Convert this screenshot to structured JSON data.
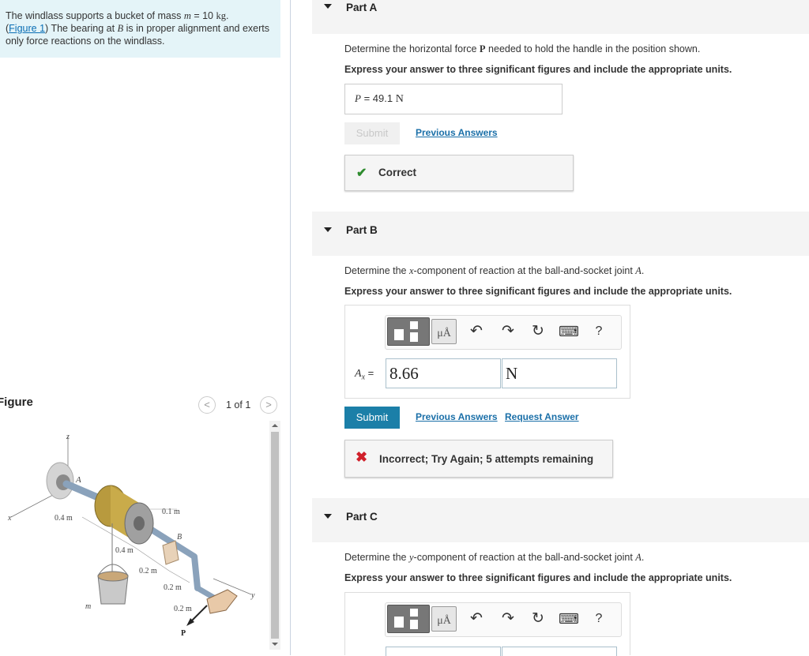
{
  "problem": {
    "text_pre": "The windlass supports a bucket of mass ",
    "mass_symbol": "m",
    "mass_equals": " = 10 ",
    "mass_unit": "kg",
    "period": ".",
    "figure_link": "Figure 1",
    "text_mid": ") The bearing at ",
    "bearing_symbol": "B",
    "text_post": " is in proper alignment and exerts only force reactions on the windlass.",
    "open_paren": "("
  },
  "figure": {
    "title": "Figure",
    "counter": "1 of 1",
    "prev": "<",
    "next": ">",
    "labels": {
      "z": "z",
      "A": "A",
      "x": "x",
      "y": "y",
      "B": "B",
      "m": "m",
      "P": "P",
      "d04a": "0.4 m",
      "d01": "0.1 m",
      "d04b": "0.4 m",
      "d02a": "0.2 m",
      "d02b": "0.2 m",
      "d02c": "0.2 m"
    }
  },
  "partA": {
    "label": "Part A",
    "question_pre": "Determine the horizontal force ",
    "question_sym": "P",
    "question_post": " needed to hold the handle in the position shown.",
    "instruction": "Express your answer to three significant figures and include the appropriate units.",
    "answer_var": "P",
    "answer_eq": " = ",
    "answer_value": "49.1",
    "answer_unit": "N",
    "submit": "Submit",
    "previous_answers": "Previous Answers",
    "feedback": "Correct"
  },
  "partB": {
    "label": "Part B",
    "question_pre": "Determine the ",
    "question_sym": "x",
    "question_post": "-component of reaction at the ball-and-socket joint ",
    "question_pt": "A",
    "question_end": ".",
    "instruction": "Express your answer to three significant figures and include the appropriate units.",
    "var_main": "A",
    "var_sub": "x",
    "var_eq": " = ",
    "value": "8.66",
    "unit": "N",
    "submit": "Submit",
    "previous_answers": "Previous Answers",
    "request_answer": "Request Answer",
    "feedback": "Incorrect; Try Again; 5 attempts remaining"
  },
  "partC": {
    "label": "Part C",
    "question_pre": "Determine the ",
    "question_sym": "y",
    "question_post": "-component of reaction at the ball-and-socket joint ",
    "question_pt": "A",
    "question_end": ".",
    "instruction": "Express your answer to three significant figures and include the appropriate units."
  },
  "toolbar": {
    "mu_label": "μÅ",
    "undo": "↶",
    "redo": "↷",
    "reset": "↻",
    "keyboard": "⌨",
    "help": "?"
  },
  "colors": {
    "submit_active": "#1b7fa8",
    "submit_disabled": "#f0f0f0",
    "correct": "#2e8b2e",
    "incorrect": "#d0202a",
    "link": "#1a6fa8"
  }
}
